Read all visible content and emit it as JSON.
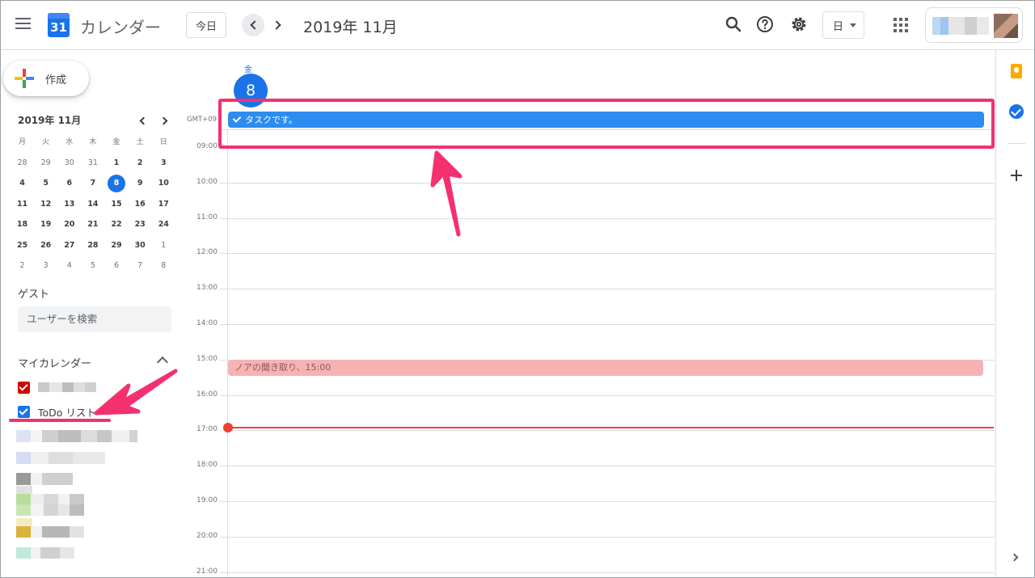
{
  "header": {
    "app_title": "カレンダー",
    "logo_number": "31",
    "today_label": "今日",
    "current_period": "2019年 11月",
    "view_label": "日"
  },
  "sidebar": {
    "create_label": "作成",
    "mini_calendar": {
      "title": "2019年 11月",
      "weekdays": [
        "月",
        "火",
        "水",
        "木",
        "金",
        "土",
        "日"
      ],
      "weeks": [
        [
          "28",
          "29",
          "30",
          "31",
          "1",
          "2",
          "3"
        ],
        [
          "4",
          "5",
          "6",
          "7",
          "8",
          "9",
          "10"
        ],
        [
          "11",
          "12",
          "13",
          "14",
          "15",
          "16",
          "17"
        ],
        [
          "18",
          "19",
          "20",
          "21",
          "22",
          "23",
          "24"
        ],
        [
          "25",
          "26",
          "27",
          "28",
          "29",
          "30",
          "1"
        ],
        [
          "2",
          "3",
          "4",
          "5",
          "6",
          "7",
          "8"
        ]
      ],
      "selected_day": "8"
    },
    "guest_title": "ゲスト",
    "guest_search_placeholder": "ユーザーを検索",
    "my_calendars_title": "マイカレンダー",
    "calendars": [
      {
        "label": "",
        "color": "#d50000",
        "checked": true
      },
      {
        "label": "ToDo リスト",
        "color": "#1a73e8",
        "checked": true
      }
    ]
  },
  "day_view": {
    "weekday": "金",
    "day_number": "8",
    "timezone": "GMT+09",
    "hours": [
      "09:00",
      "10:00",
      "11:00",
      "12:00",
      "13:00",
      "14:00",
      "15:00",
      "16:00",
      "17:00",
      "18:00",
      "19:00",
      "20:00",
      "21:00"
    ],
    "task": {
      "title": "タスクです。",
      "color": "#2d8cf0"
    },
    "event": {
      "title": "ノアの聞き取り、15:00",
      "color": "#f7b3b3"
    },
    "now_indicator_color": "#ea4335"
  },
  "annotation_color": "#f4306f"
}
